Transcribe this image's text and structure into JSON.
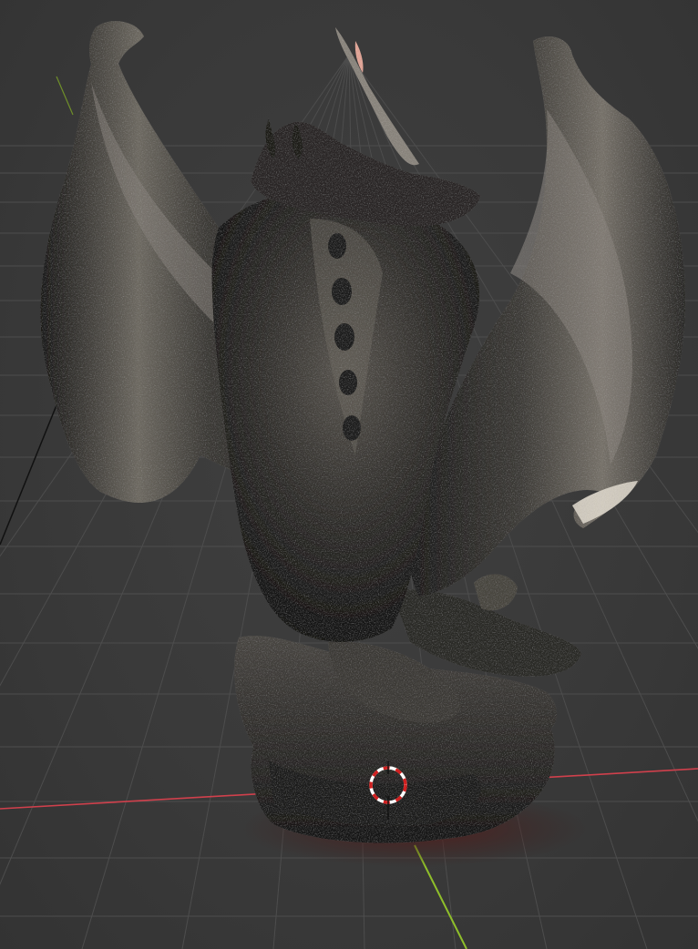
{
  "app": "3D viewport",
  "viewport": {
    "background": "#3a3a3a",
    "grid_color": "#4d4d4d",
    "x_axis_color": "#d0404c",
    "y_axis_color": "#8fbf2a",
    "z_axis_color": "#111111"
  },
  "scene": {
    "object": "dragon-sculpture-scan",
    "base_color": "#2b2a28",
    "highlight_color": "#9a9488"
  },
  "cursor": {
    "icon": "3d-cursor-icon",
    "ring_color_a": "#ffffff",
    "ring_color_b": "#d02020"
  }
}
